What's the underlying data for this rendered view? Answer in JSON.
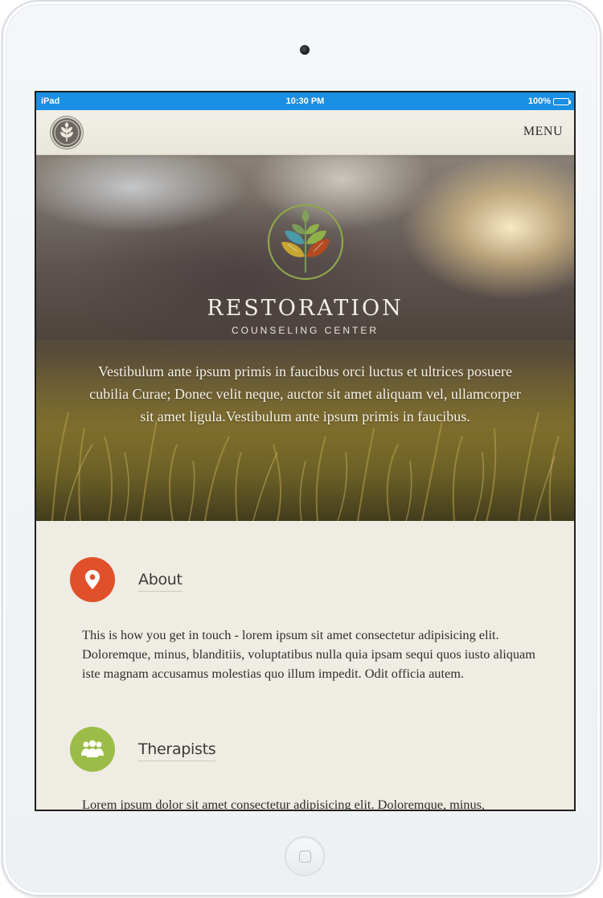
{
  "status_bar": {
    "device": "iPad",
    "time": "10:30 PM",
    "battery": "100%"
  },
  "nav": {
    "logo_icon": "leaf-logo-icon",
    "menu_label": "MENU"
  },
  "hero": {
    "brand_name": "RESTORATION",
    "brand_subtitle": "COUNSELING CENTER",
    "text": "Vestibulum ante ipsum primis in faucibus orci luctus et ultrices posuere cubilia Curae; Donec velit neque, auctor sit amet aliquam vel, ullamcorper sit amet ligula.Vestibulum ante ipsum primis in faucibus.",
    "logo_colors": [
      "#4a9aa8",
      "#8fb048",
      "#c7a532",
      "#b24a22",
      "#7a9a5a"
    ]
  },
  "sections": [
    {
      "icon": "map-pin-icon",
      "icon_color": "#e0502a",
      "title": "About",
      "text": "This is how you get in touch - lorem ipsum sit amet consectetur adipisicing elit. Doloremque, minus, blanditiis, voluptatibus nulla quia ipsam sequi quos iusto aliquam iste magnam accusamus molestias quo illum impedit. Odit officia autem."
    },
    {
      "icon": "group-icon",
      "icon_color": "#9bbd47",
      "title": "Therapists",
      "text": "Lorem ipsum dolor sit amet consectetur adipisicing elit. Doloremque, minus,"
    }
  ]
}
